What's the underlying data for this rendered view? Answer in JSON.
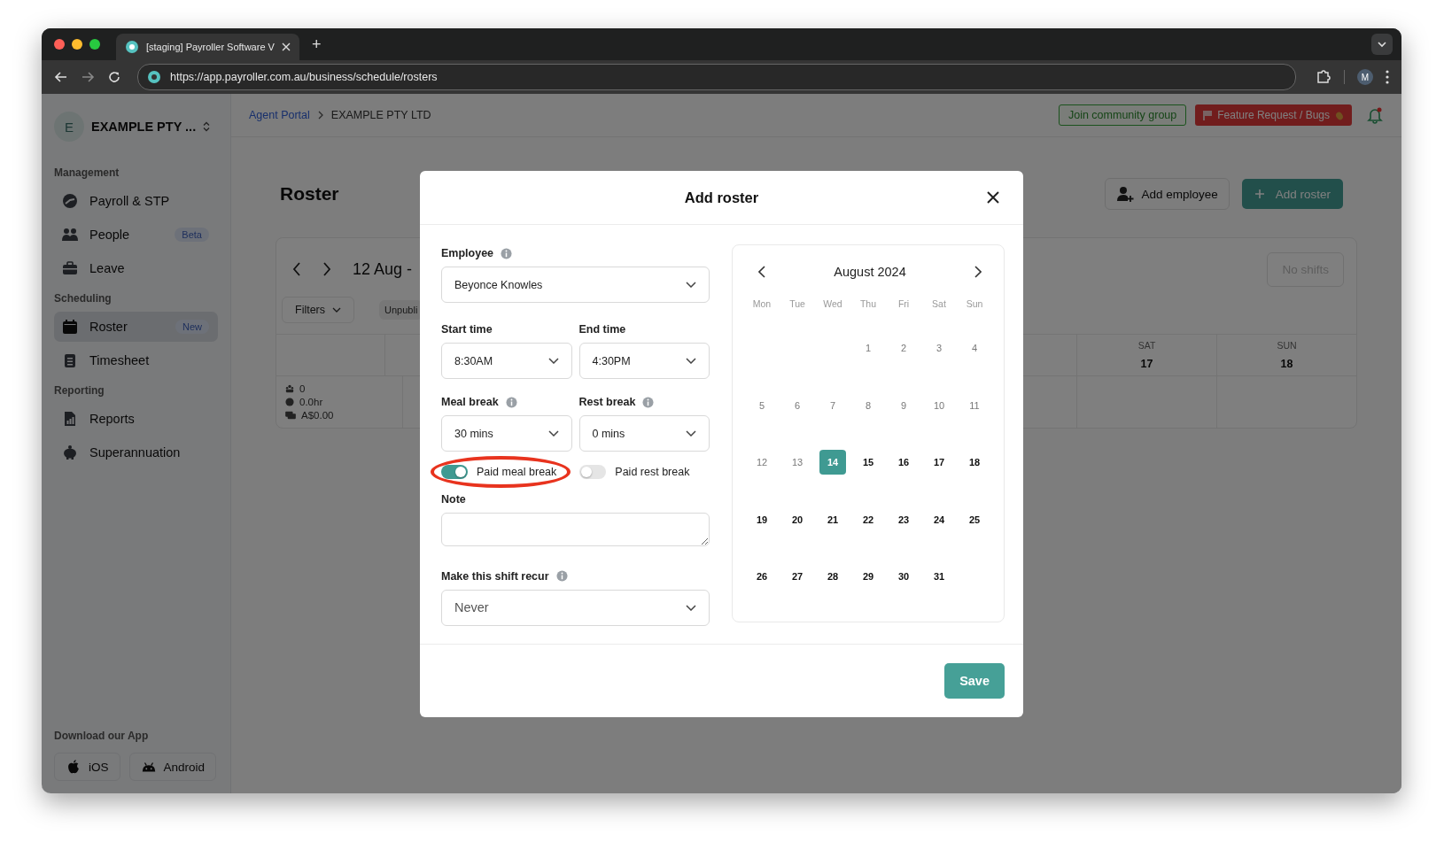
{
  "browser": {
    "tab_title": "[staging] Payroller Software V",
    "new_tab": "+",
    "url": "https://app.payroller.com.au/business/schedule/rosters",
    "profile": "M"
  },
  "sidebar": {
    "company_initial": "E",
    "company": "EXAMPLE PTY ...",
    "sections": [
      {
        "title": "Management",
        "items": [
          {
            "label": "Payroll & STP",
            "selected": false
          },
          {
            "label": "People",
            "badge": "Beta",
            "selected": false
          },
          {
            "label": "Leave",
            "selected": false
          }
        ]
      },
      {
        "title": "Scheduling",
        "items": [
          {
            "label": "Roster",
            "badge": "New",
            "selected": true
          },
          {
            "label": "Timesheet",
            "selected": false
          }
        ]
      },
      {
        "title": "Reporting",
        "items": [
          {
            "label": "Reports",
            "selected": false
          },
          {
            "label": "Superannuation",
            "selected": false
          }
        ]
      }
    ],
    "download": {
      "title": "Download our App",
      "buttons": [
        {
          "label": "iOS"
        },
        {
          "label": "Android"
        }
      ]
    }
  },
  "topbar": {
    "breadcrumb": [
      {
        "label": "Agent Portal",
        "kind": "link"
      },
      {
        "label": "EXAMPLE PTY LTD",
        "kind": "current"
      }
    ],
    "community": "Join community group",
    "feature": "Feature Request / Bugs",
    "notification": true
  },
  "roster": {
    "title": "Roster",
    "add_employee": "Add employee",
    "add_roster": "Add roster",
    "range": "12 Aug -",
    "filters": "Filters",
    "chip": "Unpubli",
    "no_shifts": "No shifts",
    "columns": [
      {
        "day": "SAT",
        "date": "17"
      },
      {
        "day": "SUN",
        "date": "18"
      }
    ],
    "summary": {
      "people": "0",
      "hours": "0.0hr",
      "cost": "A$0.00"
    }
  },
  "modal": {
    "title": "Add roster",
    "employee": {
      "label": "Employee",
      "info": true,
      "value": "Beyonce Knowles"
    },
    "start_time": {
      "label": "Start time",
      "info": false,
      "value": "8:30AM"
    },
    "end_time": {
      "label": "End time",
      "info": false,
      "value": "4:30PM"
    },
    "meal_break": {
      "label": "Meal break",
      "info": true,
      "value": "30 mins"
    },
    "rest_break": {
      "label": "Rest break",
      "info": true,
      "value": "0 mins"
    },
    "paid_meal_break": {
      "label": "Paid meal break",
      "on": true,
      "highlighted": true
    },
    "paid_rest_break": {
      "label": "Paid rest break",
      "on": false,
      "highlighted": false
    },
    "note": {
      "label": "Note"
    },
    "recur": {
      "label": "Make this shift recur",
      "info": true,
      "value": "Never"
    },
    "calendar": {
      "month": "August 2024",
      "weekdays": [
        "Mon",
        "Tue",
        "Wed",
        "Thu",
        "Fri",
        "Sat",
        "Sun"
      ],
      "weeks": [
        [
          {
            "label": "1",
            "disabled": true,
            "selected": false
          },
          {
            "label": "2",
            "disabled": true,
            "selected": false
          },
          {
            "label": "3",
            "disabled": true,
            "selected": false
          },
          {
            "label": "4",
            "disabled": true,
            "selected": false
          }
        ],
        [
          {
            "label": "5",
            "disabled": true,
            "selected": false
          },
          {
            "label": "6",
            "disabled": true,
            "selected": false
          },
          {
            "label": "7",
            "disabled": true,
            "selected": false
          },
          {
            "label": "8",
            "disabled": true,
            "selected": false
          },
          {
            "label": "9",
            "disabled": true,
            "selected": false
          },
          {
            "label": "10",
            "disabled": true,
            "selected": false
          },
          {
            "label": "11",
            "disabled": true,
            "selected": false
          }
        ],
        [
          {
            "label": "12",
            "disabled": true,
            "selected": false
          },
          {
            "label": "13",
            "disabled": true,
            "selected": false
          },
          {
            "label": "14",
            "disabled": false,
            "selected": true
          },
          {
            "label": "15",
            "disabled": false,
            "selected": false
          },
          {
            "label": "16",
            "disabled": false,
            "selected": false
          },
          {
            "label": "17",
            "disabled": false,
            "selected": false
          },
          {
            "label": "18",
            "disabled": false,
            "selected": false
          }
        ],
        [
          {
            "label": "19",
            "disabled": false,
            "selected": false
          },
          {
            "label": "20",
            "disabled": false,
            "selected": false
          },
          {
            "label": "21",
            "disabled": false,
            "selected": false
          },
          {
            "label": "22",
            "disabled": false,
            "selected": false
          },
          {
            "label": "23",
            "disabled": false,
            "selected": false
          },
          {
            "label": "24",
            "disabled": false,
            "selected": false
          },
          {
            "label": "25",
            "disabled": false,
            "selected": false
          }
        ],
        [
          {
            "label": "26",
            "disabled": false,
            "selected": false
          },
          {
            "label": "27",
            "disabled": false,
            "selected": false
          },
          {
            "label": "28",
            "disabled": false,
            "selected": false
          },
          {
            "label": "29",
            "disabled": false,
            "selected": false
          },
          {
            "label": "30",
            "disabled": false,
            "selected": false
          },
          {
            "label": "31",
            "disabled": false,
            "selected": false
          }
        ]
      ]
    },
    "save": "Save"
  }
}
